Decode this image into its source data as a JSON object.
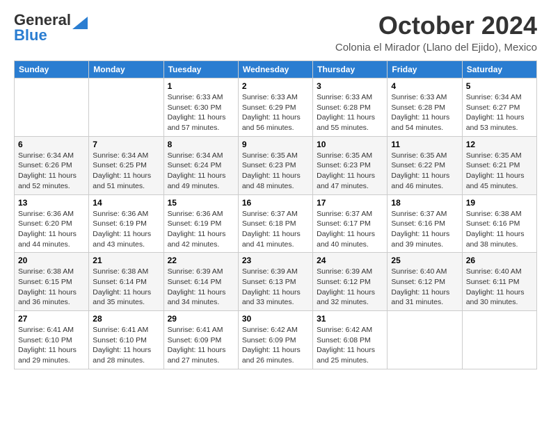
{
  "header": {
    "logo_line1": "General",
    "logo_line2": "Blue",
    "month": "October 2024",
    "location": "Colonia el Mirador (Llano del Ejido), Mexico"
  },
  "weekdays": [
    "Sunday",
    "Monday",
    "Tuesday",
    "Wednesday",
    "Thursday",
    "Friday",
    "Saturday"
  ],
  "weeks": [
    [
      {
        "day": "",
        "sunrise": "",
        "sunset": "",
        "daylight": ""
      },
      {
        "day": "",
        "sunrise": "",
        "sunset": "",
        "daylight": ""
      },
      {
        "day": "1",
        "sunrise": "Sunrise: 6:33 AM",
        "sunset": "Sunset: 6:30 PM",
        "daylight": "Daylight: 11 hours and 57 minutes."
      },
      {
        "day": "2",
        "sunrise": "Sunrise: 6:33 AM",
        "sunset": "Sunset: 6:29 PM",
        "daylight": "Daylight: 11 hours and 56 minutes."
      },
      {
        "day": "3",
        "sunrise": "Sunrise: 6:33 AM",
        "sunset": "Sunset: 6:28 PM",
        "daylight": "Daylight: 11 hours and 55 minutes."
      },
      {
        "day": "4",
        "sunrise": "Sunrise: 6:33 AM",
        "sunset": "Sunset: 6:28 PM",
        "daylight": "Daylight: 11 hours and 54 minutes."
      },
      {
        "day": "5",
        "sunrise": "Sunrise: 6:34 AM",
        "sunset": "Sunset: 6:27 PM",
        "daylight": "Daylight: 11 hours and 53 minutes."
      }
    ],
    [
      {
        "day": "6",
        "sunrise": "Sunrise: 6:34 AM",
        "sunset": "Sunset: 6:26 PM",
        "daylight": "Daylight: 11 hours and 52 minutes."
      },
      {
        "day": "7",
        "sunrise": "Sunrise: 6:34 AM",
        "sunset": "Sunset: 6:25 PM",
        "daylight": "Daylight: 11 hours and 51 minutes."
      },
      {
        "day": "8",
        "sunrise": "Sunrise: 6:34 AM",
        "sunset": "Sunset: 6:24 PM",
        "daylight": "Daylight: 11 hours and 49 minutes."
      },
      {
        "day": "9",
        "sunrise": "Sunrise: 6:35 AM",
        "sunset": "Sunset: 6:23 PM",
        "daylight": "Daylight: 11 hours and 48 minutes."
      },
      {
        "day": "10",
        "sunrise": "Sunrise: 6:35 AM",
        "sunset": "Sunset: 6:23 PM",
        "daylight": "Daylight: 11 hours and 47 minutes."
      },
      {
        "day": "11",
        "sunrise": "Sunrise: 6:35 AM",
        "sunset": "Sunset: 6:22 PM",
        "daylight": "Daylight: 11 hours and 46 minutes."
      },
      {
        "day": "12",
        "sunrise": "Sunrise: 6:35 AM",
        "sunset": "Sunset: 6:21 PM",
        "daylight": "Daylight: 11 hours and 45 minutes."
      }
    ],
    [
      {
        "day": "13",
        "sunrise": "Sunrise: 6:36 AM",
        "sunset": "Sunset: 6:20 PM",
        "daylight": "Daylight: 11 hours and 44 minutes."
      },
      {
        "day": "14",
        "sunrise": "Sunrise: 6:36 AM",
        "sunset": "Sunset: 6:19 PM",
        "daylight": "Daylight: 11 hours and 43 minutes."
      },
      {
        "day": "15",
        "sunrise": "Sunrise: 6:36 AM",
        "sunset": "Sunset: 6:19 PM",
        "daylight": "Daylight: 11 hours and 42 minutes."
      },
      {
        "day": "16",
        "sunrise": "Sunrise: 6:37 AM",
        "sunset": "Sunset: 6:18 PM",
        "daylight": "Daylight: 11 hours and 41 minutes."
      },
      {
        "day": "17",
        "sunrise": "Sunrise: 6:37 AM",
        "sunset": "Sunset: 6:17 PM",
        "daylight": "Daylight: 11 hours and 40 minutes."
      },
      {
        "day": "18",
        "sunrise": "Sunrise: 6:37 AM",
        "sunset": "Sunset: 6:16 PM",
        "daylight": "Daylight: 11 hours and 39 minutes."
      },
      {
        "day": "19",
        "sunrise": "Sunrise: 6:38 AM",
        "sunset": "Sunset: 6:16 PM",
        "daylight": "Daylight: 11 hours and 38 minutes."
      }
    ],
    [
      {
        "day": "20",
        "sunrise": "Sunrise: 6:38 AM",
        "sunset": "Sunset: 6:15 PM",
        "daylight": "Daylight: 11 hours and 36 minutes."
      },
      {
        "day": "21",
        "sunrise": "Sunrise: 6:38 AM",
        "sunset": "Sunset: 6:14 PM",
        "daylight": "Daylight: 11 hours and 35 minutes."
      },
      {
        "day": "22",
        "sunrise": "Sunrise: 6:39 AM",
        "sunset": "Sunset: 6:14 PM",
        "daylight": "Daylight: 11 hours and 34 minutes."
      },
      {
        "day": "23",
        "sunrise": "Sunrise: 6:39 AM",
        "sunset": "Sunset: 6:13 PM",
        "daylight": "Daylight: 11 hours and 33 minutes."
      },
      {
        "day": "24",
        "sunrise": "Sunrise: 6:39 AM",
        "sunset": "Sunset: 6:12 PM",
        "daylight": "Daylight: 11 hours and 32 minutes."
      },
      {
        "day": "25",
        "sunrise": "Sunrise: 6:40 AM",
        "sunset": "Sunset: 6:12 PM",
        "daylight": "Daylight: 11 hours and 31 minutes."
      },
      {
        "day": "26",
        "sunrise": "Sunrise: 6:40 AM",
        "sunset": "Sunset: 6:11 PM",
        "daylight": "Daylight: 11 hours and 30 minutes."
      }
    ],
    [
      {
        "day": "27",
        "sunrise": "Sunrise: 6:41 AM",
        "sunset": "Sunset: 6:10 PM",
        "daylight": "Daylight: 11 hours and 29 minutes."
      },
      {
        "day": "28",
        "sunrise": "Sunrise: 6:41 AM",
        "sunset": "Sunset: 6:10 PM",
        "daylight": "Daylight: 11 hours and 28 minutes."
      },
      {
        "day": "29",
        "sunrise": "Sunrise: 6:41 AM",
        "sunset": "Sunset: 6:09 PM",
        "daylight": "Daylight: 11 hours and 27 minutes."
      },
      {
        "day": "30",
        "sunrise": "Sunrise: 6:42 AM",
        "sunset": "Sunset: 6:09 PM",
        "daylight": "Daylight: 11 hours and 26 minutes."
      },
      {
        "day": "31",
        "sunrise": "Sunrise: 6:42 AM",
        "sunset": "Sunset: 6:08 PM",
        "daylight": "Daylight: 11 hours and 25 minutes."
      },
      {
        "day": "",
        "sunrise": "",
        "sunset": "",
        "daylight": ""
      },
      {
        "day": "",
        "sunrise": "",
        "sunset": "",
        "daylight": ""
      }
    ]
  ]
}
